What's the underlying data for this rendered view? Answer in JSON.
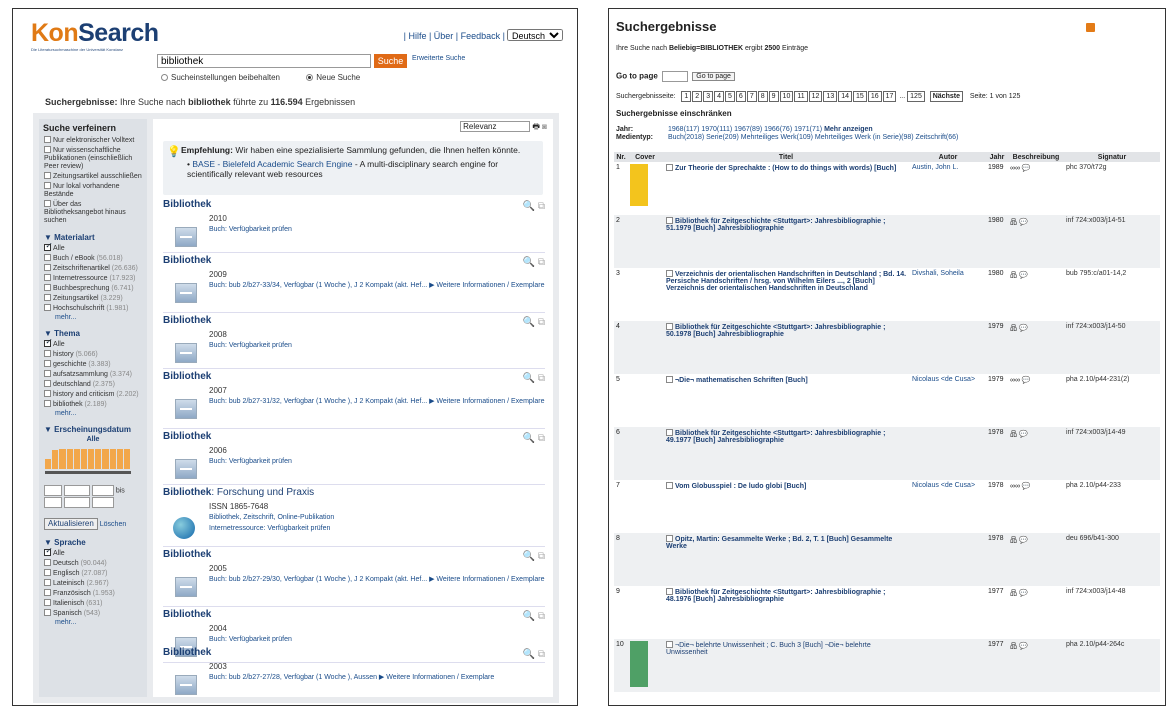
{
  "left": {
    "logo": {
      "kon": "Kon",
      "search": "Search",
      "sub": "Die Literatursuchmaschine der Universität Konstanz"
    },
    "toplinks": {
      "text": "| Hilfe | Über | Feedback |",
      "lang": "Deutsch"
    },
    "search": {
      "value": "bibliothek",
      "button": "Suche",
      "advanced": "Erweiterte Suche"
    },
    "radios": {
      "keep": "Sucheinstellungen beibehalten",
      "new": "Neue Suche"
    },
    "summary": {
      "prefix": "Suchergebnisse:",
      "text1": " Ihre Suche nach ",
      "term": "bibliothek",
      "text2": " führte zu ",
      "count": "116.594",
      "text3": " Ergebnissen"
    },
    "refine": {
      "title": "Suche verfeinern",
      "opts": [
        "Nur elektronischer Volltext",
        "Nur wissenschaftliche Publikationen (einschließlich Peer review)",
        "Zeitungsartikel ausschließen",
        "Nur lokal vorhandene Bestände",
        "Über das Bibliotheksangebot hinaus suchen"
      ]
    },
    "material": {
      "title": "▼ Materialart",
      "items": [
        {
          "label": "Alle",
          "count": ""
        },
        {
          "label": "Buch / eBook",
          "count": "(56.018)"
        },
        {
          "label": "Zeitschriftenartikel",
          "count": "(26.636)"
        },
        {
          "label": "Internetressource",
          "count": "(17.923)"
        },
        {
          "label": "Buchbesprechung",
          "count": "(6.741)"
        },
        {
          "label": "Zeitungsartikel",
          "count": "(3.229)"
        },
        {
          "label": "Hochschulschrift",
          "count": "(1.981)"
        }
      ],
      "more": "mehr..."
    },
    "thema": {
      "title": "▼ Thema",
      "items": [
        {
          "label": "Alle",
          "count": ""
        },
        {
          "label": "history",
          "count": "(5.066)"
        },
        {
          "label": "geschichte",
          "count": "(3.383)"
        },
        {
          "label": "aufsatzsammlung",
          "count": "(3.374)"
        },
        {
          "label": "deutschland",
          "count": "(2.375)"
        },
        {
          "label": "history and criticism",
          "count": "(2.202)"
        },
        {
          "label": "bibliothek",
          "count": "(2.189)"
        }
      ],
      "more": "mehr..."
    },
    "datum": {
      "title": "▼ Erscheinungsdatum",
      "all": "Alle",
      "bis": "bis",
      "apply": "Aktualisieren",
      "clear": "Löschen"
    },
    "sprache": {
      "title": "▼ Sprache",
      "items": [
        {
          "label": "Alle",
          "count": ""
        },
        {
          "label": "Deutsch",
          "count": "(90.044)"
        },
        {
          "label": "Englisch",
          "count": "(27.087)"
        },
        {
          "label": "Lateinisch",
          "count": "(2.967)"
        },
        {
          "label": "Französisch",
          "count": "(1.953)"
        },
        {
          "label": "Italienisch",
          "count": "(631)"
        },
        {
          "label": "Spanisch",
          "count": "(543)"
        }
      ],
      "more": "mehr..."
    },
    "sort": "Relevanz",
    "empfehlung": {
      "label": "Empfehlung:",
      "text": " Wir haben eine spezialisierte Sammlung gefunden, die Ihnen helfen könnte.",
      "link": "BASE - Bielefeld Academic Search Engine",
      "desc": " - A multi-disciplinary search engine for scientifically relevant web resources"
    },
    "results": [
      {
        "title": "Bibliothek",
        "year": "2010",
        "link": "Buch: Verfügbarkeit prüfen"
      },
      {
        "title": "Bibliothek",
        "year": "2009",
        "link": "Buch: bub 2/b27-33/34, Verfügbar (1 Woche ), J 2 Kompakt (akt. Hef... ▶ Weitere Informationen / Exemplare"
      },
      {
        "title": "Bibliothek",
        "year": "2008",
        "link": "Buch: Verfügbarkeit prüfen"
      },
      {
        "title": "Bibliothek",
        "year": "2007",
        "link": "Buch: bub 2/b27-31/32, Verfügbar (1 Woche ), J 2 Kompakt (akt. Hef... ▶ Weitere Informationen / Exemplare"
      },
      {
        "title": "Bibliothek",
        "year": "2006",
        "link": "Buch: Verfügbarkeit prüfen"
      },
      {
        "title": "Bibliothek",
        "sub": ": Forschung und Praxis",
        "year": "ISSN 1865-7648",
        "extra": "Bibliothek, Zeitschrift, Online-Publikation",
        "link": "Internetressource: Verfügbarkeit prüfen"
      },
      {
        "title": "Bibliothek",
        "year": "2005",
        "link": "Buch: bub 2/b27-29/30, Verfügbar (1 Woche ), J 2 Kompakt (akt. Hef... ▶ Weitere Informationen / Exemplare"
      },
      {
        "title": "Bibliothek",
        "year": "2004",
        "link": "Buch: Verfügbarkeit prüfen"
      },
      {
        "title": "Bibliothek",
        "year": "2003",
        "link": "Buch: bub 2/b27-27/28, Verfügbar (1 Woche ), Aussen ▶ Weitere Informationen / Exemplare"
      }
    ]
  },
  "right": {
    "title": "Suchergebnisse",
    "info": {
      "a": "Ihre Suche nach ",
      "b": "Beliebig=BIBLIOTHEK",
      "c": " ergibt ",
      "d": "2500",
      "e": " Einträge"
    },
    "goto": {
      "label": "Go to page",
      "btn": "Go to page"
    },
    "pages": {
      "label": "Suchergebnisseite:",
      "nums": [
        "1",
        "2",
        "3",
        "4",
        "5",
        "6",
        "7",
        "8",
        "9",
        "10",
        "11",
        "12",
        "13",
        "14",
        "15",
        "16",
        "17"
      ],
      "dots": "...",
      "last": "125",
      "next": "Nächste",
      "status": "Seite: 1 von 125"
    },
    "einschr": "Suchergebnisse einschränken",
    "jahr": {
      "label": "Jahr:",
      "text": "1968(117) 1970(111) 1967(89) 1966(76) 1971(71)",
      "more": "Mehr anzeigen"
    },
    "medien": {
      "label": "Medientyp:",
      "text": "Buch(2018) Serie(209) Mehrteiliges Werk(109) Mehrteiliges Werk (in Serie)(98) Zeitschrift(66)"
    },
    "cols": [
      "Nr.",
      "Cover",
      "Titel",
      "Autor",
      "Jahr",
      "Beschreibung",
      "Signatur"
    ],
    "rows": [
      {
        "nr": "1",
        "title": "Zur Theorie der Sprechakte : (How to do things with words) [Buch]",
        "author": "Austin, John L.",
        "year": "1989",
        "desc": "∞∞ 💬",
        "sig": "phc 370/t72g"
      },
      {
        "nr": "2",
        "title": "Bibliothek für Zeitgeschichte <Stuttgart>: Jahresbibliographie ; 51.1979 [Buch] Jahresbibliographie",
        "author": "",
        "year": "1980",
        "desc": "品 💬",
        "sig": "inf 724:x003/j14-51"
      },
      {
        "nr": "3",
        "title": "Verzeichnis der orientalischen Handschriften in Deutschland ; Bd. 14. Persische Handschriften / hrsg. von Wilhelm Eilers ..., 2 [Buch] Verzeichnis der orientalischen Handschriften in Deutschland",
        "author": "Divshali, Soheila",
        "year": "1980",
        "desc": "品 💬",
        "sig": "bub 795:c/a01-14,2"
      },
      {
        "nr": "4",
        "title": "Bibliothek für Zeitgeschichte <Stuttgart>: Jahresbibliographie ; 50.1978 [Buch] Jahresbibliographie",
        "author": "",
        "year": "1979",
        "desc": "品 💬",
        "sig": "inf 724:x003/j14-50"
      },
      {
        "nr": "5",
        "title": "¬Die¬ mathematischen Schriften [Buch]",
        "author": "Nicolaus <de Cusa>",
        "year": "1979",
        "desc": "∞∞ 💬",
        "sig": "pha 2.10/p44-231(2)"
      },
      {
        "nr": "6",
        "title": "Bibliothek für Zeitgeschichte <Stuttgart>: Jahresbibliographie ; 49.1977 [Buch] Jahresbibliographie",
        "author": "",
        "year": "1978",
        "desc": "品 💬",
        "sig": "inf 724:x003/j14-49"
      },
      {
        "nr": "7",
        "title": "Vom Globusspiel : De ludo globi [Buch]",
        "author": "Nicolaus <de Cusa>",
        "year": "1978",
        "desc": "∞∞ 💬",
        "sig": "pha 2.10/p44-233"
      },
      {
        "nr": "8",
        "title": "Opitz, Martin: Gesammelte Werke ; Bd. 2, T. 1 [Buch] Gesammelte Werke",
        "author": "",
        "year": "1978",
        "desc": "品 💬",
        "sig": "deu 696/b41-300"
      },
      {
        "nr": "9",
        "title": "Bibliothek für Zeitgeschichte <Stuttgart>: Jahresbibliographie ; 48.1976 [Buch] Jahresbibliographie",
        "author": "",
        "year": "1977",
        "desc": "品 💬",
        "sig": "inf 724:x003/j14-48"
      },
      {
        "nr": "10",
        "title": "¬Die¬ belehrte Unwissenheit ; C. Buch 3 [Buch] ¬Die¬ belehrte Unwissenheit",
        "author": "",
        "year": "1977",
        "desc": "品 💬",
        "sig": "pha 2.10/p44-264c"
      }
    ]
  }
}
